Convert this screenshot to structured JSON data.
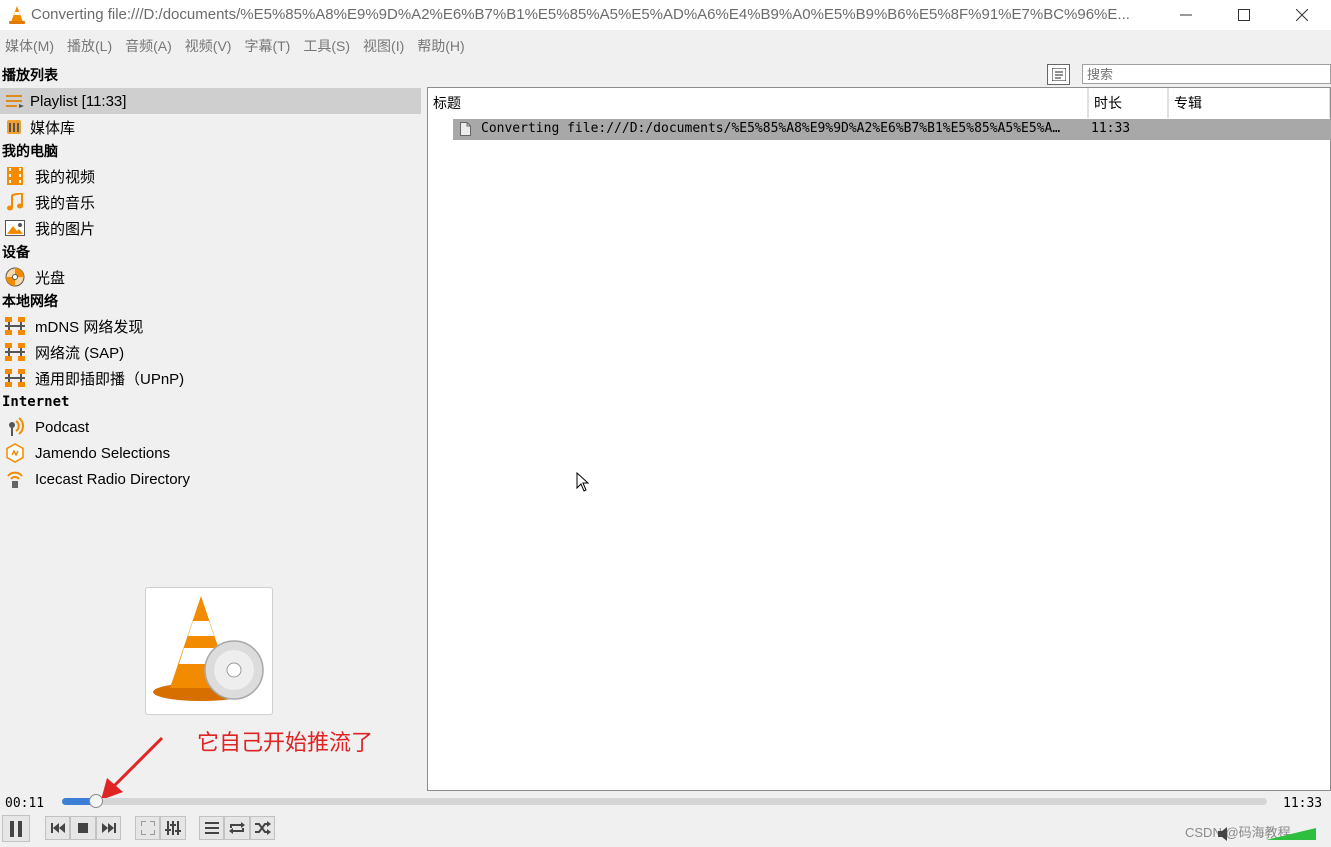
{
  "window": {
    "title": "Converting file:///D:/documents/%E5%85%A8%E9%9D%A2%E6%B7%B1%E5%85%A5%E5%AD%A6%E4%B9%A0%E5%B9%B6%E5%8F%91%E7%BC%96%E..."
  },
  "menu": [
    "媒体(M)",
    "播放(L)",
    "音频(A)",
    "视频(V)",
    "字幕(T)",
    "工具(S)",
    "视图(I)",
    "帮助(H)"
  ],
  "sidebar": {
    "playlist_header": "播放列表",
    "playlist_items": [
      {
        "label": "Playlist [11:33]",
        "icon": "playlist-icon"
      },
      {
        "label": "媒体库",
        "icon": "media-library-icon"
      }
    ],
    "computer_header": "我的电脑",
    "computer_items": [
      {
        "label": "我的视频",
        "icon": "video-icon"
      },
      {
        "label": "我的音乐",
        "icon": "music-icon"
      },
      {
        "label": "我的图片",
        "icon": "picture-icon"
      }
    ],
    "devices_header": "设备",
    "devices_items": [
      {
        "label": "光盘",
        "icon": "disc-icon"
      }
    ],
    "network_header": "本地网络",
    "network_items": [
      {
        "label": "mDNS 网络发现",
        "icon": "network-icon"
      },
      {
        "label": "网络流 (SAP)",
        "icon": "network-icon"
      },
      {
        "label": "通用即插即播（UPnP)",
        "icon": "network-icon"
      }
    ],
    "internet_header": "Internet",
    "internet_items": [
      {
        "label": "Podcast",
        "icon": "podcast-icon"
      },
      {
        "label": "Jamendo Selections",
        "icon": "jamendo-icon"
      },
      {
        "label": "Icecast Radio Directory",
        "icon": "icecast-icon"
      }
    ]
  },
  "annotation": "它自己开始推流了",
  "search": {
    "placeholder": "搜索"
  },
  "playlist_table": {
    "columns": [
      "标题",
      "时长",
      "专辑"
    ],
    "rows": [
      {
        "title": "Converting file:///D:/documents/%E5%85%A8%E9%9D%A2%E6%B7%B1%E5%85%A5%E5%A…",
        "duration": "11:33",
        "album": ""
      }
    ]
  },
  "player": {
    "elapsed": "00:11",
    "total": "11:33",
    "progress": 0.016
  },
  "watermark": "CSDN @码海教程",
  "colors": {
    "accent": "#3d7fd6",
    "vlc_orange": "#f28b00",
    "annotation": "#e02323"
  }
}
